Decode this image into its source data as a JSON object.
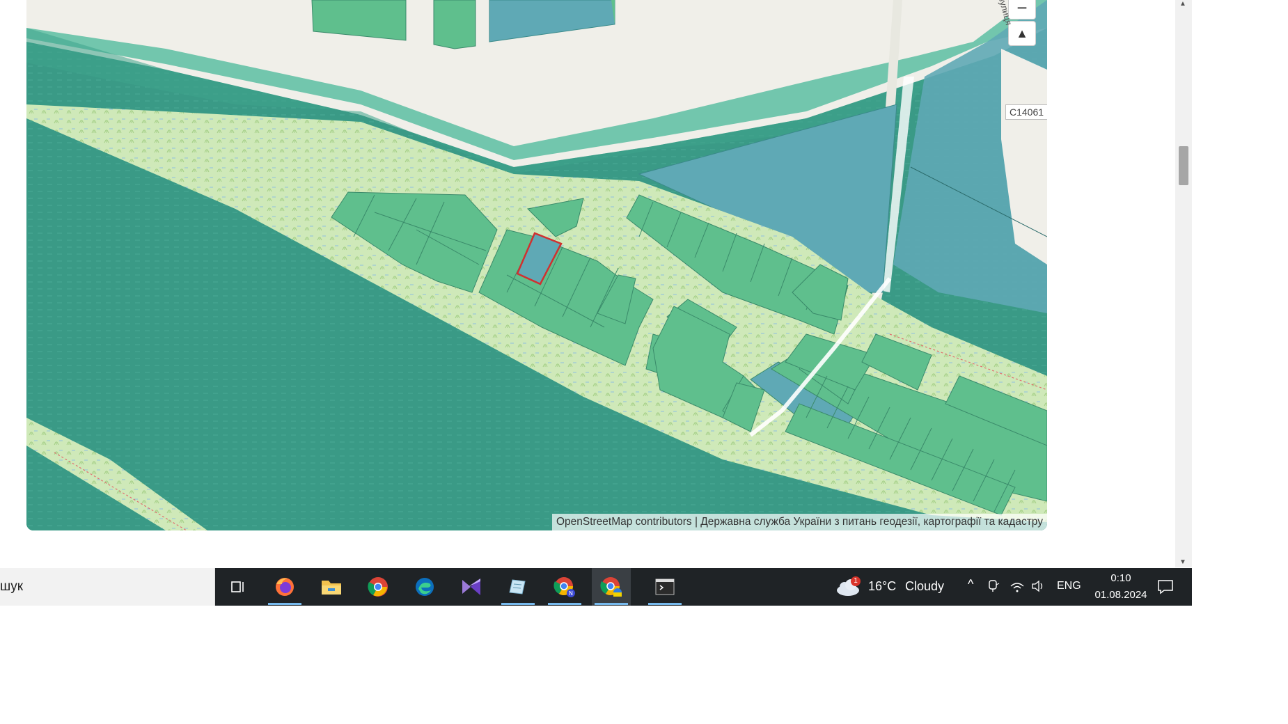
{
  "map": {
    "attribution": "OpenStreetMap contributors | Державна служба України з питань геодезії, картографії та кадастру",
    "road_label": "C14061",
    "street_label": "вулиця",
    "zoom_out_label": "−",
    "compass_label": "▲",
    "colors": {
      "water": "#3a9a86",
      "meadow": "#cfe9b9",
      "parcel": "#5fbf8d",
      "parcel_blue": "#5fa9b5",
      "road_area": "#72c6ad",
      "land": "#f0efe9",
      "highlight": "#d03030"
    }
  },
  "taskbar": {
    "search_text": "шук",
    "apps": [
      {
        "name": "task-view-icon",
        "running": false
      },
      {
        "name": "firefox-icon",
        "running": true
      },
      {
        "name": "file-explorer-icon",
        "running": false
      },
      {
        "name": "chrome-icon",
        "running": false
      },
      {
        "name": "edge-icon",
        "running": false
      },
      {
        "name": "visual-studio-icon",
        "running": false
      },
      {
        "name": "notes-app-icon",
        "running": true
      },
      {
        "name": "chrome-profile-n-icon",
        "running": true
      },
      {
        "name": "chrome-profile-ua-icon",
        "running": true
      },
      {
        "name": "terminal-icon",
        "running": true
      }
    ],
    "weather": {
      "temp": "16°C",
      "condition": "Cloudy",
      "badge": "1"
    },
    "language": "ENG",
    "time": "0:10",
    "date": "01.08.2024"
  }
}
